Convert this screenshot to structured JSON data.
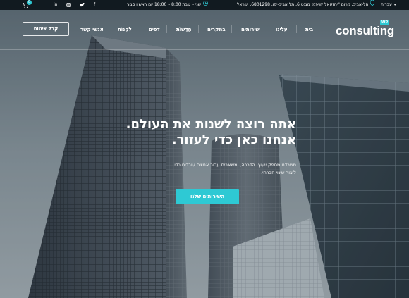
{
  "topbar": {
    "language": "עברית",
    "address": "חל-אביב, מרום \"יחזקאל קויפמן מגנט 6, תל אביב-יפו, 6801298, ישראל",
    "hours": "שני – שבת 8:00 – 18:00 יום ראשון סגור",
    "cart_count": "0"
  },
  "header": {
    "logo_text": "consulting",
    "logo_badge": "WP",
    "nav": [
      "בית",
      "עלינו",
      "שירותים",
      "במקרים",
      "חֲדָשׁוֹת",
      "דפים",
      "לִקְנוֹת",
      "אנשי קשר"
    ],
    "cta_label": "קבל ציטוט"
  },
  "hero": {
    "title_line1": "אתה רוצה לשנות את העולם.",
    "title_line2": "אנחנו כאן כדי לעזור.",
    "subtitle_line1": "משרדנו מספק ייעוץ, הדרכה, ומשאבים עבור אנשים עובדים כדי",
    "subtitle_line2": "ליצור שינוי חברתי.",
    "button_label": "השירותים שלנו"
  },
  "colors": {
    "accent": "#2ec9d4",
    "topbar_bg": "#0c141a"
  }
}
